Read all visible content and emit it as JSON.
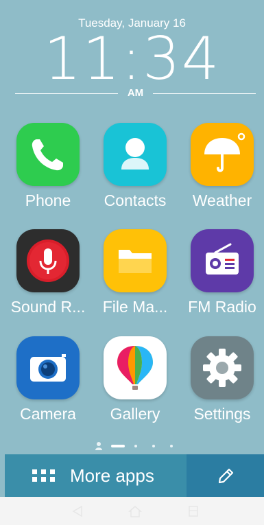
{
  "lockclock": {
    "date": "Tuesday, January 16",
    "time": "11:34",
    "ampm": "AM"
  },
  "apps": [
    {
      "label": "Phone",
      "icon": "phone-icon",
      "color": "#2ecc4f"
    },
    {
      "label": "Contacts",
      "icon": "contacts-icon",
      "color": "#19c3d6"
    },
    {
      "label": "Weather",
      "icon": "weather-icon",
      "color": "#ffb300"
    },
    {
      "label": "Sound R...",
      "icon": "microphone-icon",
      "color": "#2d2d2d"
    },
    {
      "label": "File Ma...",
      "icon": "folder-icon",
      "color": "#ffc107"
    },
    {
      "label": "FM Radio",
      "icon": "radio-icon",
      "color": "#5e3aa8"
    },
    {
      "label": "Camera",
      "icon": "camera-icon",
      "color": "#1e6fc7"
    },
    {
      "label": "Gallery",
      "icon": "gallery-balloon-icon",
      "color": "#ffffff"
    },
    {
      "label": "Settings",
      "icon": "settings-gear-icon",
      "color": "#6f8389"
    }
  ],
  "dock": {
    "more_apps_label": "More apps",
    "more_apps_icon": "grid-icon",
    "edit_icon": "pencil-icon"
  },
  "pager": {
    "pages": 4,
    "current": 1
  },
  "navbar": [
    "back-icon",
    "home-icon",
    "recents-icon"
  ]
}
